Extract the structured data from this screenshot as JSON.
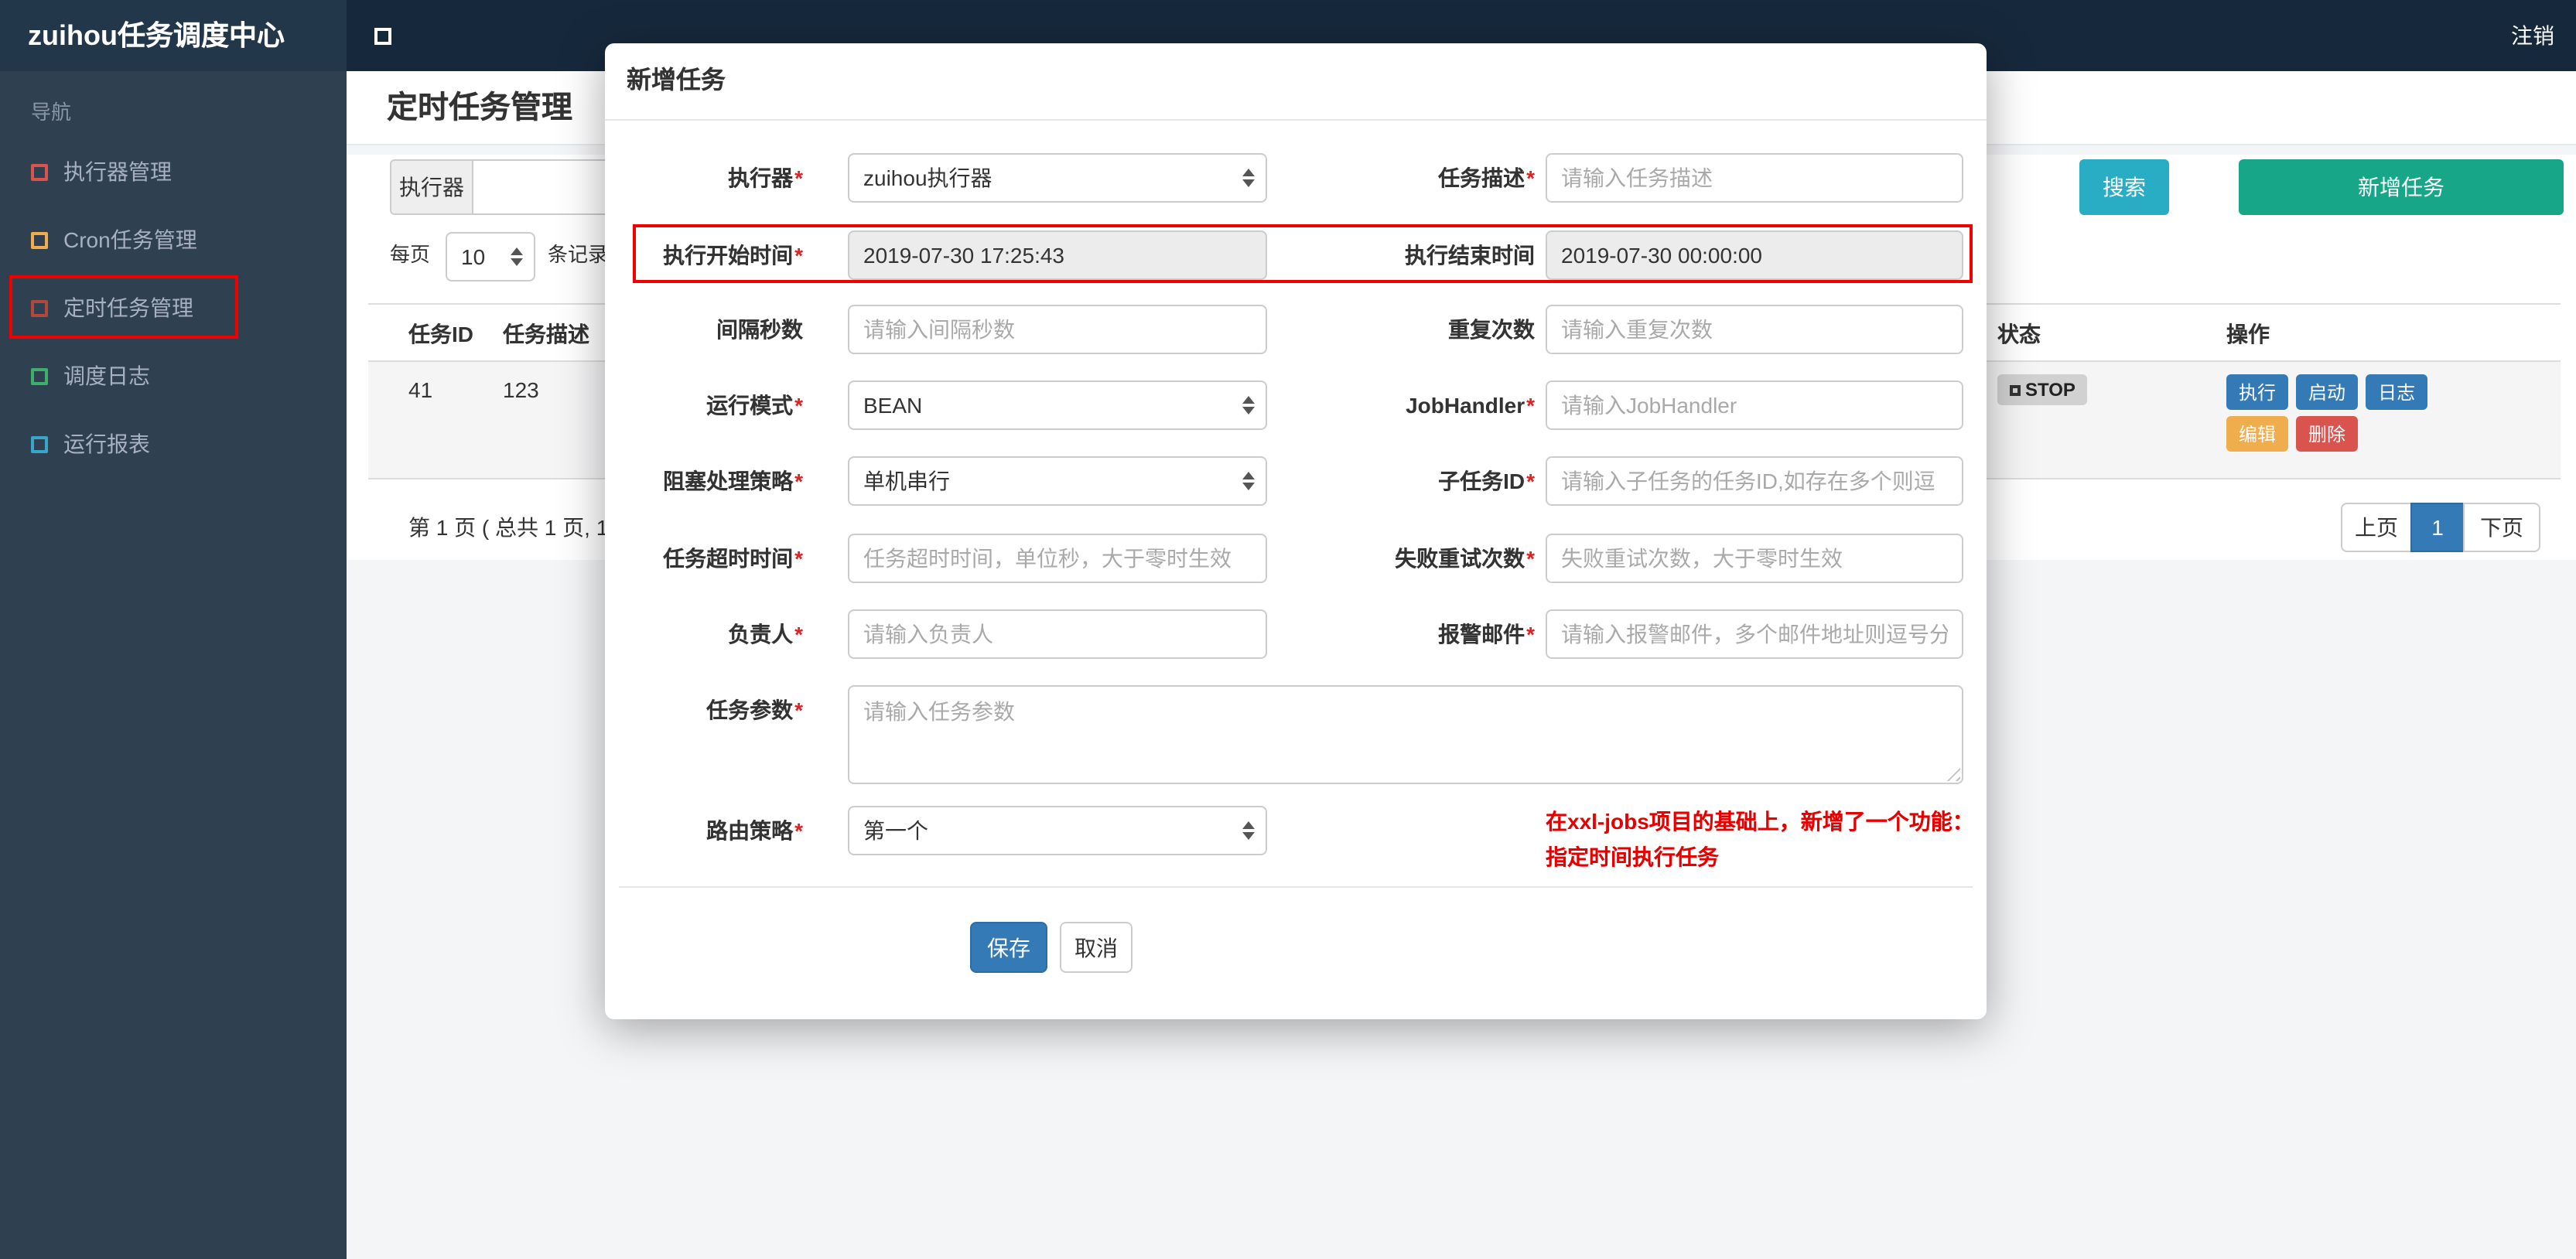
{
  "ui": {
    "required_mark": "*"
  },
  "colors": {
    "teal_search": "#28adc4",
    "green_add": "#18a689",
    "blue_primary": "#337ab7",
    "orange_warning": "#f0ad4e",
    "red_danger": "#d9534f",
    "red_annotation": "#f20000",
    "red_required": "#e02020",
    "note_red": "#e60000",
    "badge_gray": "#d1d1d1"
  },
  "topbar": {
    "brand": "zuihou任务调度中心",
    "logout": "注销"
  },
  "sidebar": {
    "nav_label": "导航",
    "items": [
      {
        "label": "执行器管理",
        "icon_color": "#d9534f"
      },
      {
        "label": "Cron任务管理",
        "icon_color": "#f0ad4e"
      },
      {
        "label": "定时任务管理",
        "icon_color": "#b0483e"
      },
      {
        "label": "调度日志",
        "icon_color": "#3fae6a"
      },
      {
        "label": "运行报表",
        "icon_color": "#3aa4c9"
      }
    ]
  },
  "page": {
    "title": "定时任务管理",
    "filter": {
      "executor_label": "执行器",
      "search": "搜索",
      "add_task": "新增任务"
    },
    "per_page": {
      "prefix": "每页",
      "value": "10",
      "suffix": "条记录"
    },
    "table": {
      "headers": {
        "id": "任务ID",
        "desc": "任务描述",
        "status": "状态",
        "actions": "操作"
      },
      "row": {
        "id": "41",
        "desc": "123",
        "status": "STOP",
        "actions": {
          "run": "执行",
          "start": "启动",
          "log": "日志",
          "edit": "编辑",
          "del": "删除"
        }
      }
    },
    "pagination": {
      "info": "第 1 页 ( 总共 1 页, 1",
      "prev": "上页",
      "current": "1",
      "next": "下页"
    }
  },
  "modal": {
    "title": "新增任务",
    "fields": {
      "executor": {
        "label": "执行器",
        "value": "zuihou执行器"
      },
      "job_desc": {
        "label": "任务描述",
        "placeholder": "请输入任务描述"
      },
      "start_time": {
        "label": "执行开始时间",
        "value": "2019-07-30 17:25:43"
      },
      "end_time": {
        "label": "执行结束时间",
        "value": "2019-07-30 00:00:00"
      },
      "interval_sec": {
        "label": "间隔秒数",
        "placeholder": "请输入间隔秒数"
      },
      "repeat_count": {
        "label": "重复次数",
        "placeholder": "请输入重复次数"
      },
      "run_mode": {
        "label": "运行模式",
        "value": "BEAN"
      },
      "job_handler": {
        "label": "JobHandler",
        "placeholder": "请输入JobHandler"
      },
      "block_strategy": {
        "label": "阻塞处理策略",
        "value": "单机串行"
      },
      "child_job_id": {
        "label": "子任务ID",
        "placeholder": "请输入子任务的任务ID,如存在多个则逗"
      },
      "timeout": {
        "label": "任务超时时间",
        "placeholder": "任务超时时间，单位秒，大于零时生效"
      },
      "fail_retry": {
        "label": "失败重试次数",
        "placeholder": "失败重试次数，大于零时生效"
      },
      "owner": {
        "label": "负责人",
        "placeholder": "请输入负责人"
      },
      "alarm_email": {
        "label": "报警邮件",
        "placeholder": "请输入报警邮件，多个邮件地址则逗号分"
      },
      "job_params": {
        "label": "任务参数",
        "placeholder": "请输入任务参数"
      },
      "route_strategy": {
        "label": "路由策略",
        "value": "第一个"
      }
    },
    "note": {
      "line1": "在xxl-jobs项目的基础上，新增了一个功能：",
      "line2": "指定时间执行任务"
    },
    "footer": {
      "save": "保存",
      "cancel": "取消"
    }
  }
}
